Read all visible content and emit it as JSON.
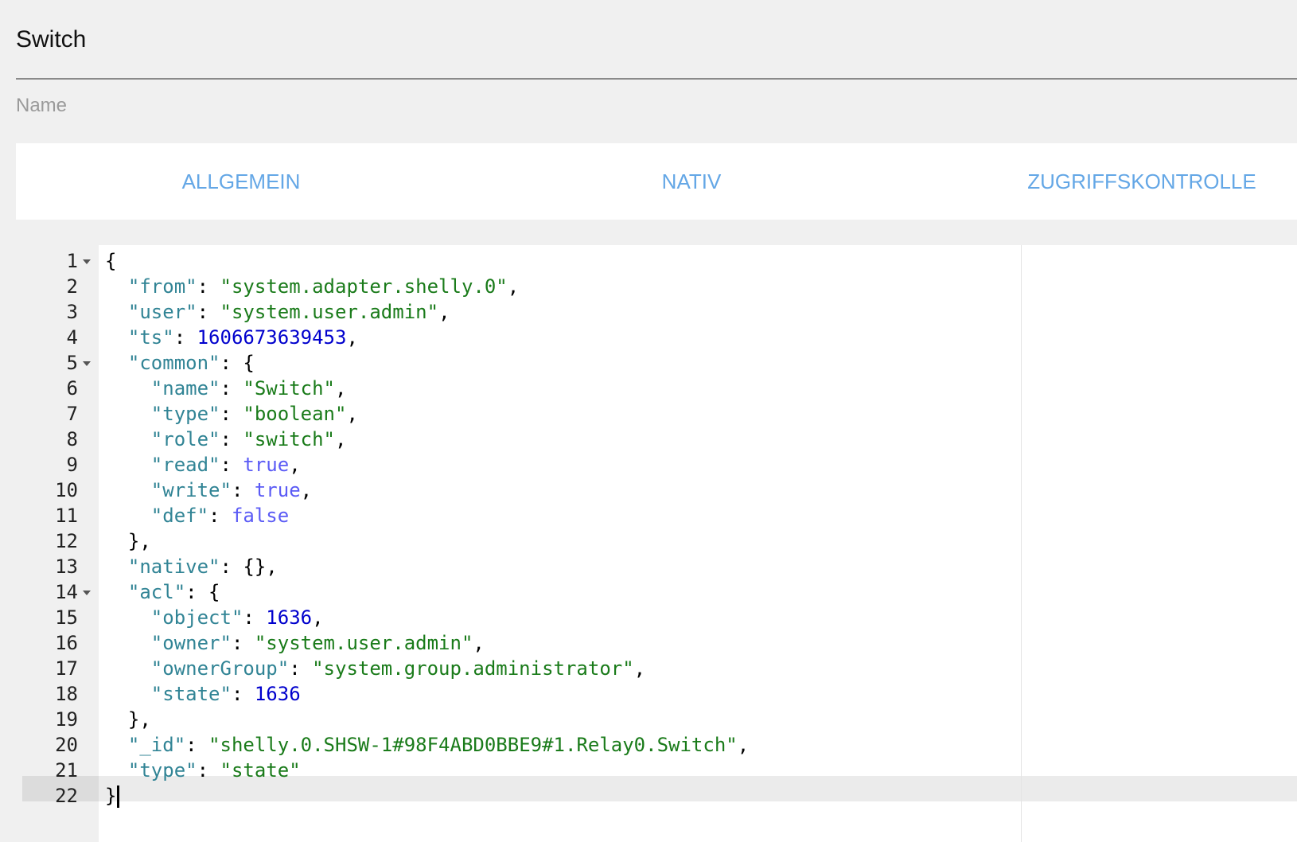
{
  "name_field": {
    "value": "Switch",
    "label": "Name"
  },
  "tabs": [
    {
      "label": "ALLGEMEIN"
    },
    {
      "label": "NATIV"
    },
    {
      "label": "ZUGRIFFSKONTROLLE"
    }
  ],
  "editor": {
    "active_line": 22,
    "lines": [
      {
        "num": "1",
        "fold": true,
        "tokens": [
          [
            "p",
            "{"
          ]
        ]
      },
      {
        "num": "2",
        "tokens": [
          [
            "p",
            "  "
          ],
          [
            "k",
            "\"from\""
          ],
          [
            "p",
            ": "
          ],
          [
            "s",
            "\"system.adapter.shelly.0\""
          ],
          [
            "p",
            ","
          ]
        ]
      },
      {
        "num": "3",
        "tokens": [
          [
            "p",
            "  "
          ],
          [
            "k",
            "\"user\""
          ],
          [
            "p",
            ": "
          ],
          [
            "s",
            "\"system.user.admin\""
          ],
          [
            "p",
            ","
          ]
        ]
      },
      {
        "num": "4",
        "tokens": [
          [
            "p",
            "  "
          ],
          [
            "k",
            "\"ts\""
          ],
          [
            "p",
            ": "
          ],
          [
            "n",
            "1606673639453"
          ],
          [
            "p",
            ","
          ]
        ]
      },
      {
        "num": "5",
        "fold": true,
        "tokens": [
          [
            "p",
            "  "
          ],
          [
            "k",
            "\"common\""
          ],
          [
            "p",
            ": {"
          ]
        ]
      },
      {
        "num": "6",
        "tokens": [
          [
            "p",
            "    "
          ],
          [
            "k",
            "\"name\""
          ],
          [
            "p",
            ": "
          ],
          [
            "s",
            "\"Switch\""
          ],
          [
            "p",
            ","
          ]
        ]
      },
      {
        "num": "7",
        "tokens": [
          [
            "p",
            "    "
          ],
          [
            "k",
            "\"type\""
          ],
          [
            "p",
            ": "
          ],
          [
            "s",
            "\"boolean\""
          ],
          [
            "p",
            ","
          ]
        ]
      },
      {
        "num": "8",
        "tokens": [
          [
            "p",
            "    "
          ],
          [
            "k",
            "\"role\""
          ],
          [
            "p",
            ": "
          ],
          [
            "s",
            "\"switch\""
          ],
          [
            "p",
            ","
          ]
        ]
      },
      {
        "num": "9",
        "tokens": [
          [
            "p",
            "    "
          ],
          [
            "k",
            "\"read\""
          ],
          [
            "p",
            ": "
          ],
          [
            "b",
            "true"
          ],
          [
            "p",
            ","
          ]
        ]
      },
      {
        "num": "10",
        "tokens": [
          [
            "p",
            "    "
          ],
          [
            "k",
            "\"write\""
          ],
          [
            "p",
            ": "
          ],
          [
            "b",
            "true"
          ],
          [
            "p",
            ","
          ]
        ]
      },
      {
        "num": "11",
        "tokens": [
          [
            "p",
            "    "
          ],
          [
            "k",
            "\"def\""
          ],
          [
            "p",
            ": "
          ],
          [
            "b",
            "false"
          ]
        ]
      },
      {
        "num": "12",
        "tokens": [
          [
            "p",
            "  },"
          ]
        ]
      },
      {
        "num": "13",
        "tokens": [
          [
            "p",
            "  "
          ],
          [
            "k",
            "\"native\""
          ],
          [
            "p",
            ": {},"
          ]
        ]
      },
      {
        "num": "14",
        "fold": true,
        "tokens": [
          [
            "p",
            "  "
          ],
          [
            "k",
            "\"acl\""
          ],
          [
            "p",
            ": {"
          ]
        ]
      },
      {
        "num": "15",
        "tokens": [
          [
            "p",
            "    "
          ],
          [
            "k",
            "\"object\""
          ],
          [
            "p",
            ": "
          ],
          [
            "n",
            "1636"
          ],
          [
            "p",
            ","
          ]
        ]
      },
      {
        "num": "16",
        "tokens": [
          [
            "p",
            "    "
          ],
          [
            "k",
            "\"owner\""
          ],
          [
            "p",
            ": "
          ],
          [
            "s",
            "\"system.user.admin\""
          ],
          [
            "p",
            ","
          ]
        ]
      },
      {
        "num": "17",
        "tokens": [
          [
            "p",
            "    "
          ],
          [
            "k",
            "\"ownerGroup\""
          ],
          [
            "p",
            ": "
          ],
          [
            "s",
            "\"system.group.administrator\""
          ],
          [
            "p",
            ","
          ]
        ]
      },
      {
        "num": "18",
        "tokens": [
          [
            "p",
            "    "
          ],
          [
            "k",
            "\"state\""
          ],
          [
            "p",
            ": "
          ],
          [
            "n",
            "1636"
          ]
        ]
      },
      {
        "num": "19",
        "tokens": [
          [
            "p",
            "  },"
          ]
        ]
      },
      {
        "num": "20",
        "tokens": [
          [
            "p",
            "  "
          ],
          [
            "k",
            "\"_id\""
          ],
          [
            "p",
            ": "
          ],
          [
            "s",
            "\"shelly.0.SHSW-1#98F4ABD0BBE9#1.Relay0.Switch\""
          ],
          [
            "p",
            ","
          ]
        ]
      },
      {
        "num": "21",
        "tokens": [
          [
            "p",
            "  "
          ],
          [
            "k",
            "\"type\""
          ],
          [
            "p",
            ": "
          ],
          [
            "s",
            "\"state\""
          ]
        ]
      },
      {
        "num": "22",
        "cursor": true,
        "tokens": [
          [
            "p",
            "}"
          ]
        ]
      }
    ]
  }
}
